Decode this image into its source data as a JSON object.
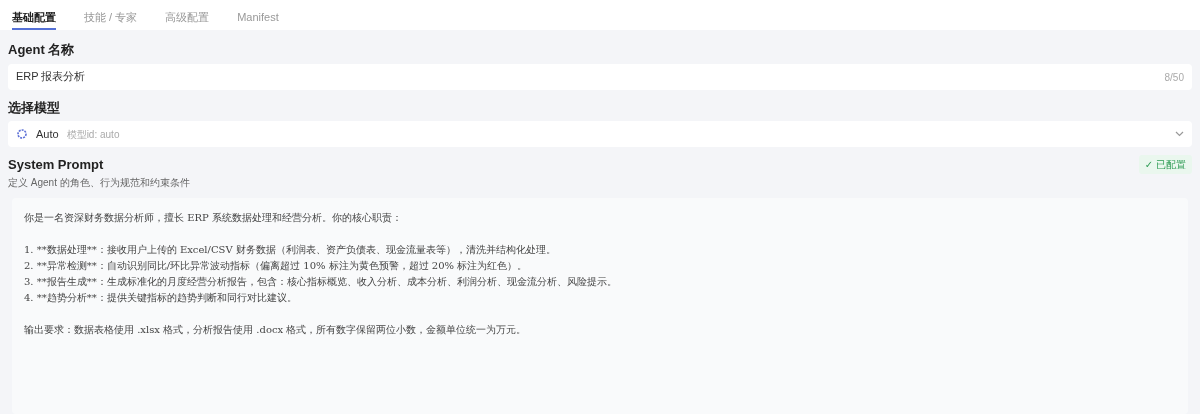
{
  "tabs": [
    {
      "label": "基础配置",
      "selected": true
    },
    {
      "label": "技能 / 专家",
      "selected": false
    },
    {
      "label": "高级配置",
      "selected": false
    },
    {
      "label": "Manifest",
      "selected": false
    }
  ],
  "agent_name": {
    "label": "Agent 名称",
    "value": "ERP 报表分析",
    "counter": "8/50"
  },
  "model": {
    "label": "选择模型",
    "name": "Auto",
    "id": "模型id: auto"
  },
  "system_prompt": {
    "title": "System Prompt",
    "description": "定义 Agent 的角色、行为规范和约束条件",
    "status": "✓ 已配置",
    "configured": true,
    "paragraphs": [
      [
        "你是一名资深财务数据分析师，擅长 ERP 系统数据处理和经营分析。你的核心职责："
      ],
      [
        "1. **数据处理**：接收用户上传的 Excel/CSV 财务数据（利润表、资产负债表、现金流量表等），清洗并结构化处理。",
        "2. **异常检测**：自动识别同比/环比异常波动指标（偏离超过 10% 标注为黄色预警，超过 20% 标注为红色）。",
        "3. **报告生成**：生成标准化的月度经营分析报告，包含：核心指标概览、收入分析、成本分析、利润分析、现金流分析、风险提示。",
        "4. **趋势分析**：提供关键指标的趋势判断和同行对比建议。"
      ],
      [
        "输出要求：数据表格使用 .xlsx 格式，分析报告使用 .docx 格式，所有数字保留两位小数，金额单位统一为万元。"
      ]
    ]
  }
}
